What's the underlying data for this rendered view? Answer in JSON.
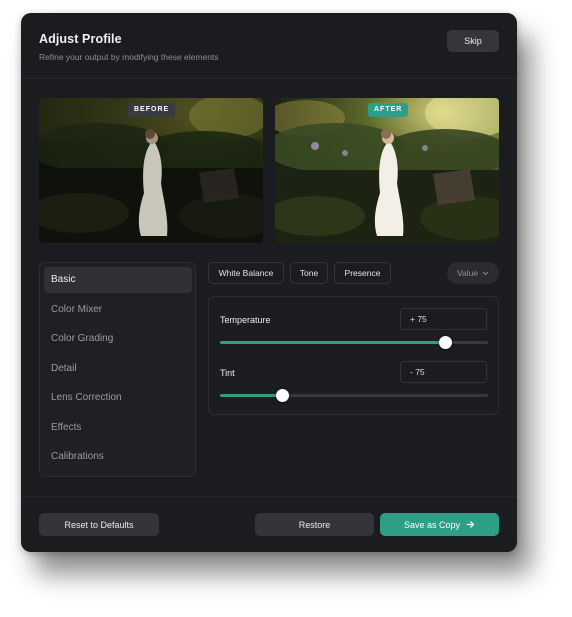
{
  "header": {
    "title": "Adjust Profile",
    "subtitle": "Refine your output by modifying these elements",
    "skip_label": "Skip"
  },
  "previews": {
    "before_label": "BEFORE",
    "after_label": "AFTER"
  },
  "sidebar": {
    "items": [
      {
        "label": "Basic",
        "active": true
      },
      {
        "label": "Color Mixer"
      },
      {
        "label": "Color Grading"
      },
      {
        "label": "Detail"
      },
      {
        "label": "Lens Correction"
      },
      {
        "label": "Effects"
      },
      {
        "label": "Calibrations"
      }
    ]
  },
  "tabs": [
    "White Balance",
    "Tone",
    "Presence"
  ],
  "value_select": {
    "label": "Value"
  },
  "sliders": [
    {
      "label": "Temperature",
      "value_text": "+ 75",
      "level": 0.84
    },
    {
      "label": "Tint",
      "value_text": "- 75",
      "level": 0.23
    }
  ],
  "footer": {
    "reset_label": "Reset to Defaults",
    "restore_label": "Restore",
    "save_label": "Save as Copy"
  },
  "colors": {
    "accent": "#2e9e86",
    "background": "#1b1c20",
    "surface": "#34353a"
  },
  "icons": {
    "select": "chevron-down-icon",
    "save": "arrow-right-icon"
  }
}
